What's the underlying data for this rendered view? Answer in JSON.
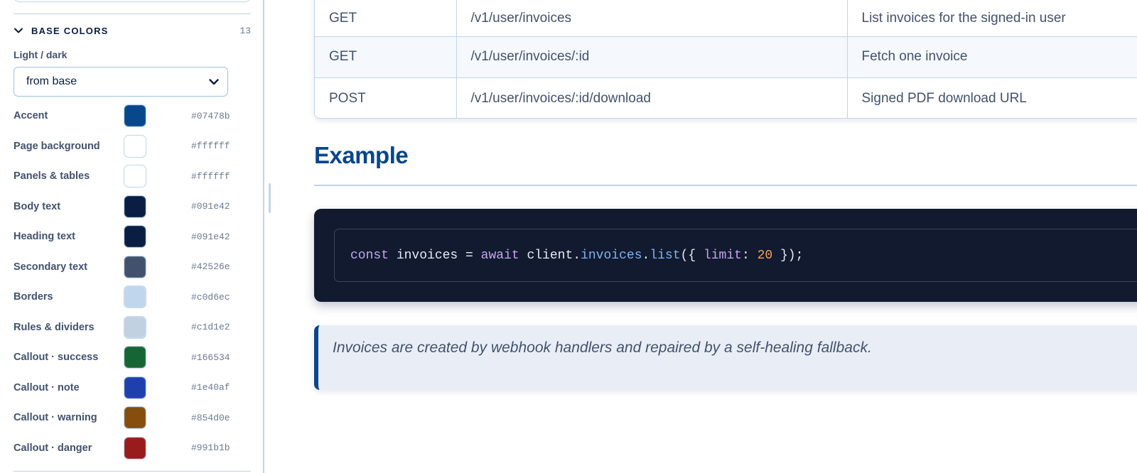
{
  "sidebar": {
    "section": {
      "title": "BASE COLORS",
      "count": "13",
      "icon": "chevron-down-icon"
    },
    "mode": {
      "label": "Light / dark",
      "value": "from base",
      "icon": "chevron-down-icon"
    },
    "colors": [
      {
        "label": "Accent",
        "hex": "#07478b",
        "swatch": "#07478b"
      },
      {
        "label": "Page background",
        "hex": "#ffffff",
        "swatch": "#ffffff"
      },
      {
        "label": "Panels & tables",
        "hex": "#ffffff",
        "swatch": "#ffffff"
      },
      {
        "label": "Body text",
        "hex": "#091e42",
        "swatch": "#091e42"
      },
      {
        "label": "Heading text",
        "hex": "#091e42",
        "swatch": "#091e42"
      },
      {
        "label": "Secondary text",
        "hex": "#42526e",
        "swatch": "#42526e"
      },
      {
        "label": "Borders",
        "hex": "#c0d6ec",
        "swatch": "#c0d6ec"
      },
      {
        "label": "Rules & dividers",
        "hex": "#c1d1e2",
        "swatch": "#c1d1e2"
      },
      {
        "label": "Callout · success",
        "hex": "#166534",
        "swatch": "#166534"
      },
      {
        "label": "Callout · note",
        "hex": "#1e40af",
        "swatch": "#1e40af"
      },
      {
        "label": "Callout · warning",
        "hex": "#854d0e",
        "swatch": "#854d0e"
      },
      {
        "label": "Callout · danger",
        "hex": "#991b1b",
        "swatch": "#991b1b"
      }
    ]
  },
  "main": {
    "endpoints": [
      {
        "method": "GET",
        "path": "/v1/user/invoices",
        "description": "List invoices for the signed-in user"
      },
      {
        "method": "GET",
        "path": "/v1/user/invoices/:id",
        "description": "Fetch one invoice"
      },
      {
        "method": "POST",
        "path": "/v1/user/invoices/:id/download",
        "description": "Signed PDF download URL"
      }
    ],
    "example_heading": "Example",
    "code_tokens": {
      "kw_const": "const",
      "t_invoices_var": " invoices = ",
      "kw_await": "await",
      "t_client": " client.",
      "p_invoices": "invoices",
      "t_dot": ".",
      "p_list": "list",
      "t_open": "({ ",
      "k_limit": "limit",
      "t_colon": ": ",
      "n_20": "20",
      "t_close": " });"
    },
    "callout": "Invoices are created by webhook handlers and repaired by a self-healing fallback."
  },
  "colors": {
    "accent": "#07478b",
    "border": "#c0d6ec",
    "rule": "#c1d1e2",
    "code_bg": "#111a2e",
    "callout_bg": "#e9eef6"
  }
}
